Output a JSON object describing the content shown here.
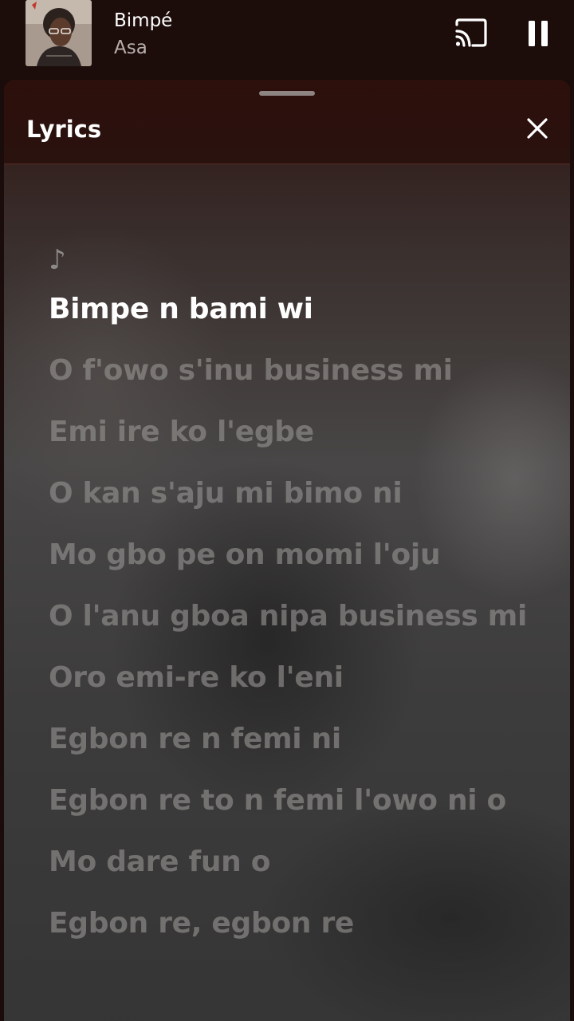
{
  "now_playing": {
    "title": "Bimpé",
    "artist": "Asa",
    "icons": {
      "cast": "cast-icon",
      "pause": "pause-icon"
    }
  },
  "lyrics_sheet": {
    "title": "Lyrics",
    "close_icon": "close-icon",
    "intro_symbol": "♪",
    "active_index": 0,
    "lines": [
      "Bimpe n bami wi",
      "O f'owo s'inu business mi",
      "Emi ire ko l'egbe",
      "O kan s'aju mi bimo ni",
      "Mo gbo pe on momi l'oju",
      "O l'anu gboa nipa business mi",
      "Oro emi-re ko l'eni",
      "Egbon re n femi ni",
      "Egbon re to n femi l'owo ni o",
      "Mo dare fun o",
      "Egbon re, egbon re"
    ]
  },
  "colors": {
    "header_bg": "#1c0d0a",
    "active_lyric": "#ffffff",
    "inactive_lyric": "#96948f"
  }
}
